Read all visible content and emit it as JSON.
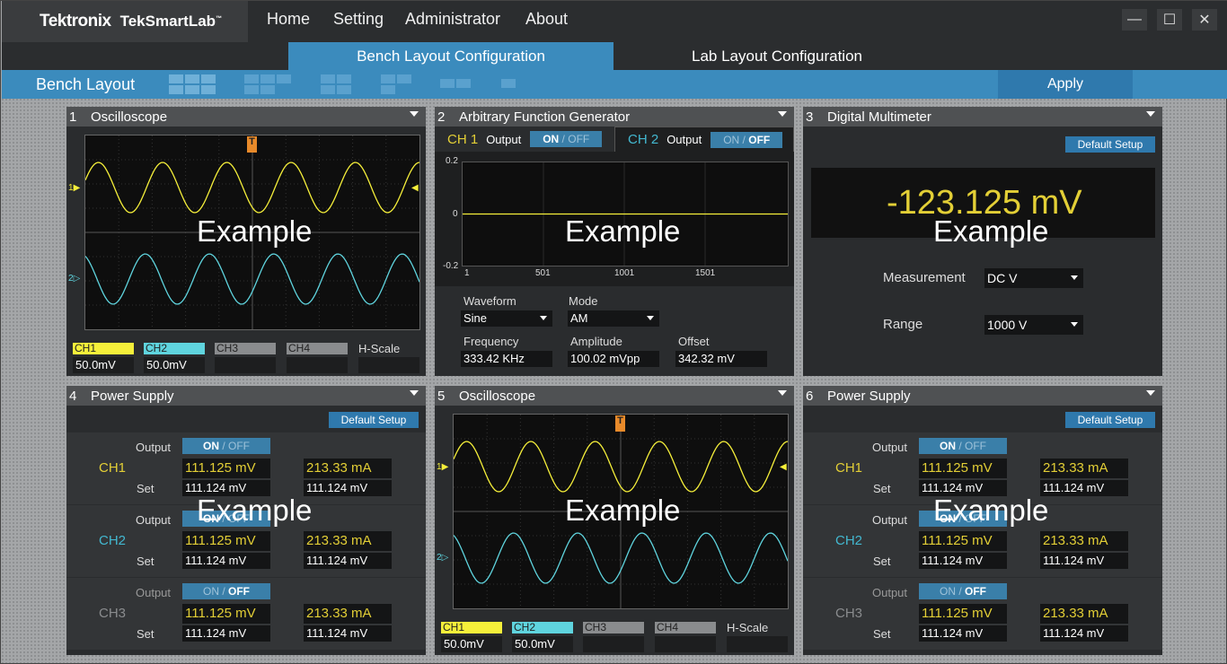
{
  "app": {
    "brand": "Tektronix",
    "product": "TekSmartLab",
    "tm": "™"
  },
  "nav": [
    "Home",
    "Setting",
    "Administrator",
    "About"
  ],
  "window": {
    "minimize": "—",
    "maximize": "☐",
    "close": "✕"
  },
  "tabs": {
    "bench": "Bench Layout Configuration",
    "lab": "Lab Layout Configuration"
  },
  "layoutbar": {
    "label": "Bench Layout",
    "apply": "Apply"
  },
  "watermark": "Example",
  "p1": {
    "num": "1",
    "title": "Oscilloscope",
    "markers": {
      "trigger": "T",
      "ch1": "1",
      "ch2": "2"
    },
    "channels": [
      {
        "name": "CH1",
        "value": "50.0mV",
        "color": "#f5ef3a"
      },
      {
        "name": "CH2",
        "value": "50.0mV",
        "color": "#5fd4de"
      },
      {
        "name": "CH3",
        "value": ""
      },
      {
        "name": "CH4",
        "value": ""
      }
    ],
    "hscale": "H-Scale"
  },
  "p2": {
    "num": "2",
    "title": "Arbitrary Function Generator",
    "ch1": {
      "label": "CH 1",
      "output": "Output",
      "on": "ON",
      "sep": "/",
      "off": "OFF",
      "selected": "ON"
    },
    "ch2": {
      "label": "CH 2",
      "output": "Output",
      "on": "ON",
      "sep": "/",
      "off": "OFF",
      "selected": "OFF"
    },
    "plot": {
      "y_ticks": [
        "0.2",
        "0",
        "-0.2"
      ],
      "x_ticks": [
        "1",
        "501",
        "1001",
        "1501"
      ]
    },
    "waveform": {
      "label": "Waveform",
      "value": "Sine"
    },
    "mode": {
      "label": "Mode",
      "value": "AM"
    },
    "frequency": {
      "label": "Frequency",
      "value": "333.42 KHz"
    },
    "amplitude": {
      "label": "Amplitude",
      "value": "100.02 mVpp"
    },
    "offset": {
      "label": "Offset",
      "value": "342.32 mV"
    }
  },
  "p3": {
    "num": "3",
    "title": "Digital Multimeter",
    "default_setup": "Default Setup",
    "reading": "-123.125 mV",
    "measurement": {
      "label": "Measurement",
      "value": "DC V"
    },
    "range": {
      "label": "Range",
      "value": "1000 V"
    }
  },
  "p4": {
    "num": "4",
    "title": "Power Supply",
    "default_setup": "Default Setup",
    "channels": [
      {
        "name": "CH1",
        "output": "Output",
        "on": "ON",
        "sep": "/",
        "off": "OFF",
        "state": "ON",
        "voltage": "111.125 mV",
        "current": "213.33 mA",
        "set": "Set",
        "set_v": "111.124 mV",
        "set_i": "111.124 mV"
      },
      {
        "name": "CH2",
        "output": "Output",
        "on": "ON",
        "sep": "/",
        "off": "OFF",
        "state": "ON",
        "voltage": "111.125 mV",
        "current": "213.33 mA",
        "set": "Set",
        "set_v": "111.124 mV",
        "set_i": "111.124 mV"
      },
      {
        "name": "CH3",
        "output": "Output",
        "on": "ON",
        "sep": "/",
        "off": "OFF",
        "state": "OFF",
        "voltage": "111.125 mV",
        "current": "213.33 mA",
        "set": "Set",
        "set_v": "111.124 mV",
        "set_i": "111.124 mV"
      }
    ]
  },
  "p5": {
    "num": "5",
    "title": "Oscilloscope",
    "markers": {
      "trigger": "T",
      "ch1": "1",
      "ch2": "2"
    },
    "channels": [
      {
        "name": "CH1",
        "value": "50.0mV",
        "color": "#f5ef3a"
      },
      {
        "name": "CH2",
        "value": "50.0mV",
        "color": "#5fd4de"
      },
      {
        "name": "CH3",
        "value": ""
      },
      {
        "name": "CH4",
        "value": ""
      }
    ],
    "hscale": "H-Scale"
  },
  "p6": {
    "num": "6",
    "title": "Power Supply",
    "default_setup": "Default Setup",
    "channels": [
      {
        "name": "CH1",
        "output": "Output",
        "on": "ON",
        "sep": "/",
        "off": "OFF",
        "state": "ON",
        "voltage": "111.125 mV",
        "current": "213.33 mA",
        "set": "Set",
        "set_v": "111.124 mV",
        "set_i": "111.124 mV"
      },
      {
        "name": "CH2",
        "output": "Output",
        "on": "ON",
        "sep": "/",
        "off": "OFF",
        "state": "ON",
        "voltage": "111.125 mV",
        "current": "213.33 mA",
        "set": "Set",
        "set_v": "111.124 mV",
        "set_i": "111.124 mV"
      },
      {
        "name": "CH3",
        "output": "Output",
        "on": "ON",
        "sep": "/",
        "off": "OFF",
        "state": "OFF",
        "voltage": "111.125 mV",
        "current": "213.33 mA",
        "set": "Set",
        "set_v": "111.124 mV",
        "set_i": "111.124 mV"
      }
    ]
  },
  "colors": {
    "accent": "#3b8bbd",
    "ch1": "#f5ef3a",
    "ch2": "#5fd4de",
    "reading": "#e3cf36",
    "trigger": "#e88a2a"
  }
}
